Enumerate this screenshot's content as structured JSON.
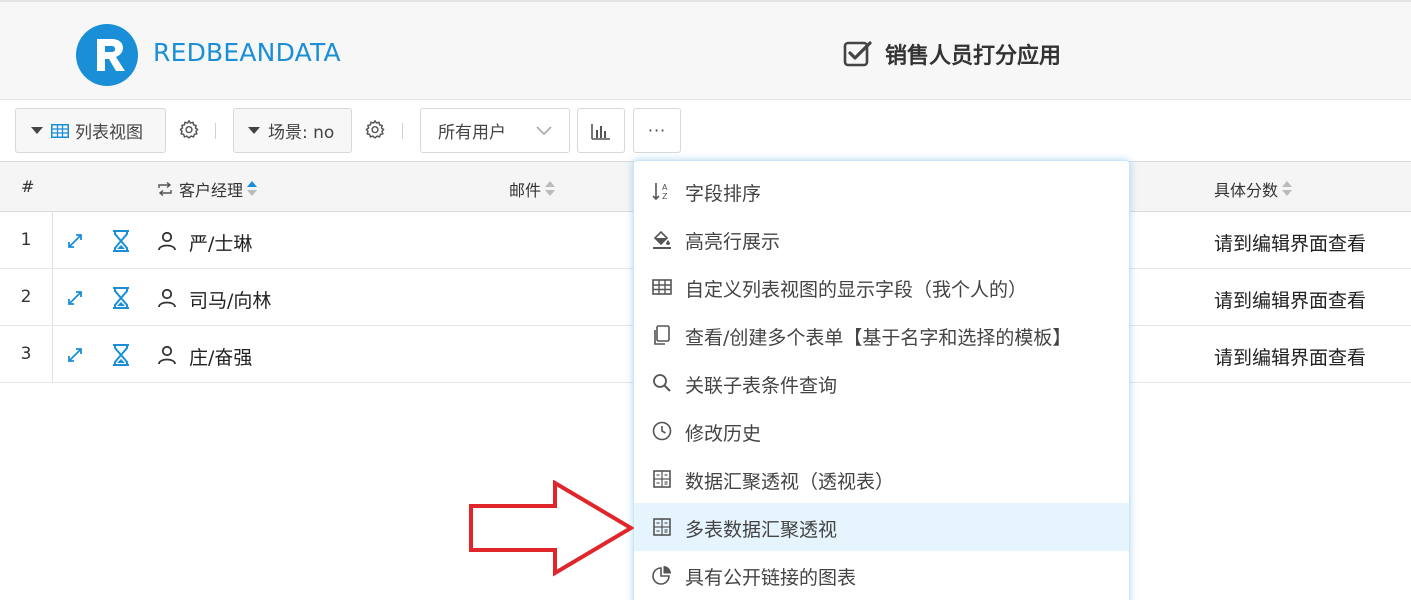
{
  "header": {
    "logo_letter": "R",
    "brand": "REDBEANDATA",
    "app_title": "销售人员打分应用"
  },
  "toolbar": {
    "view_button_label": "列表视图",
    "scene_button_label": "场景: no",
    "user_filter_value": "所有用户",
    "more_label": "···"
  },
  "table": {
    "columns": {
      "index": "#",
      "manager": "客户经理",
      "email": "邮件",
      "score": "具体分数"
    },
    "rows": [
      {
        "index": "1",
        "manager": "严/士琳",
        "score": "请到编辑界面查看"
      },
      {
        "index": "2",
        "manager": "司马/向林",
        "score": "请到编辑界面查看"
      },
      {
        "index": "3",
        "manager": "庄/奋强",
        "score": "请到编辑界面查看"
      }
    ]
  },
  "menu": {
    "items": [
      {
        "label": "字段排序",
        "icon": "sort-az-icon"
      },
      {
        "label": "高亮行展示",
        "icon": "paint-bucket-icon"
      },
      {
        "label": "自定义列表视图的显示字段（我个人的）",
        "icon": "table-grid-icon"
      },
      {
        "label": "查看/创建多个表单【基于名字和选择的模板】",
        "icon": "copy-forms-icon"
      },
      {
        "label": "关联子表条件查询",
        "icon": "search-icon"
      },
      {
        "label": "修改历史",
        "icon": "clock-history-icon"
      },
      {
        "label": "数据汇聚透视（透视表）",
        "icon": "calculator-icon"
      },
      {
        "label": "多表数据汇聚透视",
        "icon": "calculator-icon"
      },
      {
        "label": "具有公开链接的图表",
        "icon": "pie-chart-icon"
      }
    ],
    "highlighted_index": 7
  },
  "colors": {
    "accent": "#1a8fd8",
    "menu_highlight": "#e6f5fd",
    "arrow": "#e0262a"
  }
}
